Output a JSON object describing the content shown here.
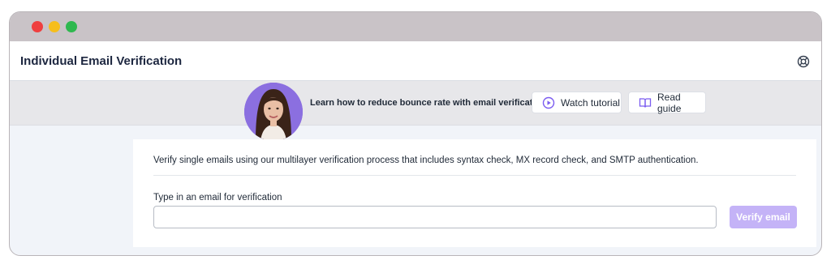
{
  "window": {
    "controls": [
      "close",
      "minimize",
      "maximize"
    ]
  },
  "header": {
    "title": "Individual Email Verification",
    "help_icon": "lifebuoy-icon"
  },
  "banner": {
    "text": "Learn how to reduce bounce rate with email verification",
    "watch_tutorial_label": "Watch tutorial",
    "watch_icon": "play-circle-icon",
    "read_guide_label": "Read guide",
    "guide_icon": "book-open-icon",
    "avatar": "presenter-avatar"
  },
  "card": {
    "description": "Verify single emails using our multilayer verification process that includes syntax check, MX record check, and SMTP authentication.",
    "field_label": "Type in an email for verification",
    "input_value": "",
    "verify_label": "Verify email"
  },
  "colors": {
    "accent": "#7b5cf0",
    "button_disabled": "#c4b3f7",
    "title_text": "#1d2740"
  }
}
